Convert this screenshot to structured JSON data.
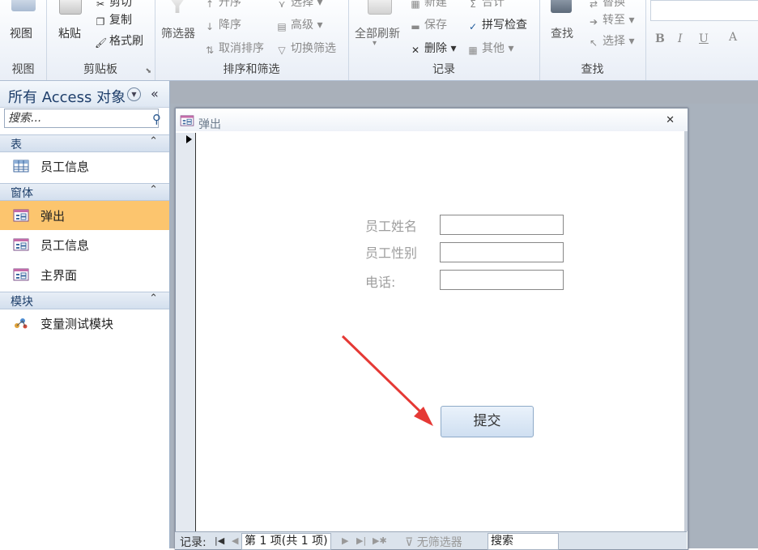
{
  "ribbon": {
    "views": {
      "label": "视图",
      "group": "视图"
    },
    "clipboard": {
      "paste": "粘贴",
      "cut": "剪切",
      "copy": "复制",
      "format_painter": "格式刷",
      "group": "剪贴板"
    },
    "sort_filter": {
      "filter": "筛选器",
      "ascending": "升序",
      "descending": "降序",
      "remove_sort": "取消排序",
      "selection": "选择",
      "advanced": "高级",
      "toggle_filter": "切换筛选",
      "group": "排序和筛选"
    },
    "records": {
      "refresh_all": "全部刷新",
      "new": "新建",
      "save": "保存",
      "delete": "删除",
      "totals": "合计",
      "spelling": "拼写检查",
      "more": "其他",
      "group": "记录"
    },
    "find": {
      "find": "查找",
      "replace": "替换",
      "goto": "转至",
      "select": "选择",
      "group": "查找"
    },
    "text_format": {
      "bold": "B",
      "italic": "I",
      "underline": "U",
      "font_color": "A"
    }
  },
  "nav": {
    "title": "所有 Access 对象",
    "collapse": "«",
    "search_placeholder": "搜索...",
    "sections": [
      {
        "label": "表",
        "items": [
          {
            "label": "员工信息",
            "icon": "table-icon"
          }
        ]
      },
      {
        "label": "窗体",
        "items": [
          {
            "label": "弹出",
            "icon": "form-icon",
            "selected": true
          },
          {
            "label": "员工信息",
            "icon": "form-icon"
          },
          {
            "label": "主界面",
            "icon": "form-icon"
          }
        ]
      },
      {
        "label": "模块",
        "items": [
          {
            "label": "变量测试模块",
            "icon": "module-icon"
          }
        ]
      }
    ]
  },
  "form": {
    "title": "弹出",
    "close": "✕",
    "fields": [
      {
        "label": "员工姓名",
        "value": ""
      },
      {
        "label": "员工性别",
        "value": ""
      },
      {
        "label": "电话:",
        "value": ""
      }
    ],
    "submit": "提交"
  },
  "status": {
    "record_label": "记录:",
    "record_pos": "第 1 项(共 1 项)",
    "no_filter": "无筛选器",
    "search": "搜索"
  },
  "colors": {
    "selected_item": "#fcc56e",
    "annotation_arrow": "#e53935",
    "nav_title": "#1f3f6b"
  }
}
